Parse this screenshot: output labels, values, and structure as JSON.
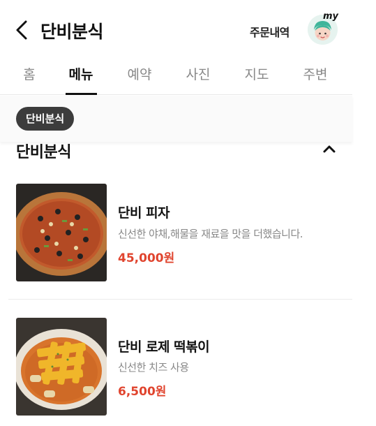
{
  "header": {
    "title": "단비분식",
    "orders_label": "주문내역",
    "avatar_badge": "my"
  },
  "tabs": [
    {
      "label": "홈"
    },
    {
      "label": "메뉴"
    },
    {
      "label": "예약"
    },
    {
      "label": "사진"
    },
    {
      "label": "지도"
    },
    {
      "label": "주변"
    }
  ],
  "active_tab": "메뉴",
  "category_chip": "단비분식",
  "section": {
    "title": "단비분식"
  },
  "menu_items": [
    {
      "name": "단비 피자",
      "description": "신선한 야채,해물을 재료을 맛을 더했습니다.",
      "price": "45,000원"
    },
    {
      "name": "단비 로제 떡볶이",
      "description": "신선한 치즈 사용",
      "price": "6,500원"
    }
  ],
  "colors": {
    "price": "#e0442e",
    "chip_bg": "#3c3c3c",
    "avatar_bg": "#e6f3ef"
  }
}
